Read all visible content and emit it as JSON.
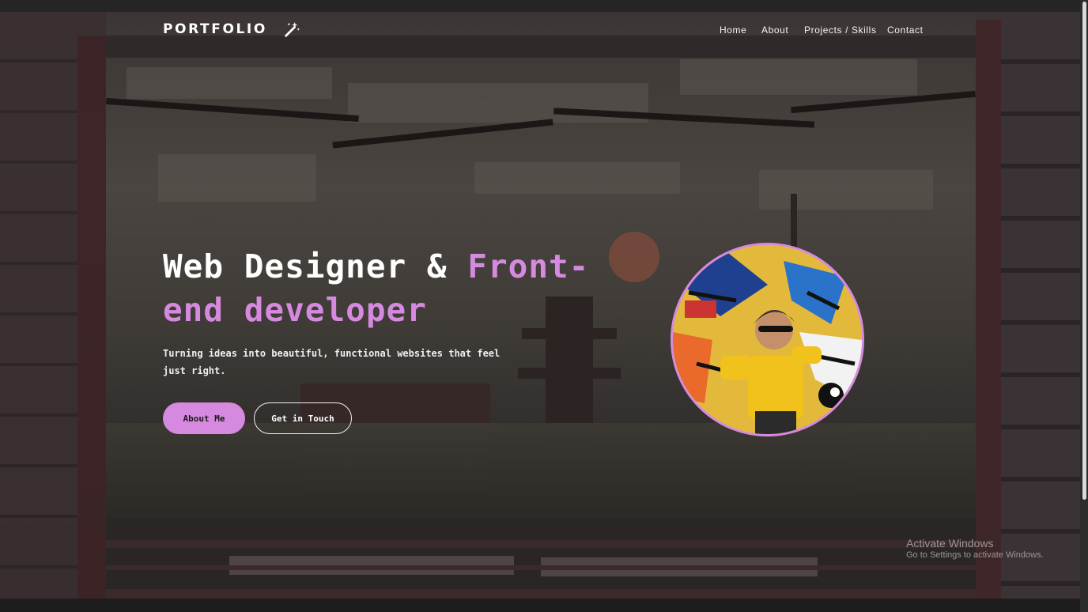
{
  "nav": {
    "logo_text": "PORTFOLIO",
    "logo_icon": "magic-wand-icon",
    "items": [
      {
        "label": "Home"
      },
      {
        "label": "About"
      },
      {
        "label": "Projects / Skills"
      },
      {
        "label": "Contact"
      }
    ]
  },
  "hero": {
    "headline_part1": "Web Designer & ",
    "headline_part2": "Front-end developer",
    "subtitle": "Turning ideas into beautiful, functional websites that feel just right.",
    "primary_button": "About Me",
    "secondary_button": "Get in Touch",
    "avatar": "profile-photo"
  },
  "watermark": {
    "title": "Activate Windows",
    "subtitle": "Go to Settings to activate Windows."
  },
  "colors": {
    "accent": "#d58ae0",
    "background": "#2a2626",
    "text": "#ffffff"
  }
}
